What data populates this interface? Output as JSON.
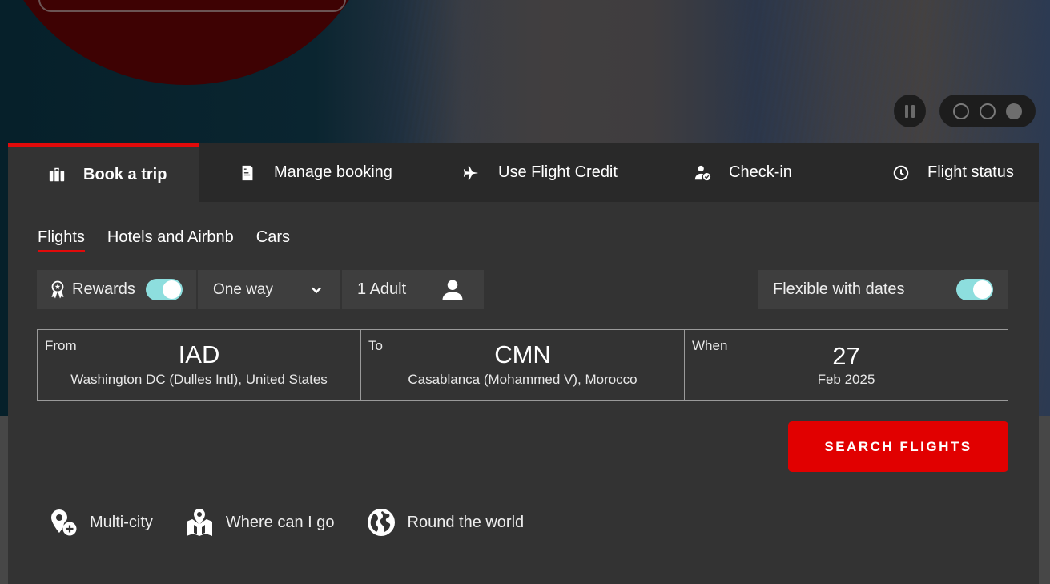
{
  "hero": {
    "carousel": {
      "pause_icon": "pause-icon",
      "slides": [
        {
          "active": false
        },
        {
          "active": false
        },
        {
          "active": true
        }
      ]
    }
  },
  "tabs": [
    {
      "id": "book",
      "label": "Book a trip",
      "icon": "suitcase-icon",
      "active": true
    },
    {
      "id": "manage",
      "label": "Manage booking",
      "icon": "document-icon",
      "active": false
    },
    {
      "id": "credit",
      "label": "Use Flight Credit",
      "icon": "plane-icon",
      "active": false
    },
    {
      "id": "checkin",
      "label": "Check-in",
      "icon": "person-check-icon",
      "active": false
    },
    {
      "id": "status",
      "label": "Flight status",
      "icon": "clock-icon",
      "active": false
    }
  ],
  "subtabs": [
    {
      "label": "Flights",
      "active": true
    },
    {
      "label": "Hotels and Airbnb",
      "active": false
    },
    {
      "label": "Cars",
      "active": false
    }
  ],
  "options": {
    "rewards_label": "Rewards",
    "rewards_on": true,
    "trip_type": "One way",
    "passengers": "1 Adult",
    "flexible_label": "Flexible with dates",
    "flexible_on": true
  },
  "route": {
    "from": {
      "label": "From",
      "code": "IAD",
      "desc": "Washington DC (Dulles Intl), United States"
    },
    "to": {
      "label": "To",
      "code": "CMN",
      "desc": "Casablanca (Mohammed V), Morocco"
    },
    "when": {
      "label": "When",
      "day": "27",
      "month_year": "Feb 2025"
    }
  },
  "search_button": "SEARCH FLIGHTS",
  "extras": [
    {
      "label": "Multi-city",
      "icon": "pin-plus-icon"
    },
    {
      "label": "Where can I go",
      "icon": "map-pin-icon"
    },
    {
      "label": "Round the world",
      "icon": "globe-icon"
    }
  ],
  "colors": {
    "accent_red": "#e10000",
    "toggle_on": "#8ddede",
    "panel_bg": "#333333"
  }
}
